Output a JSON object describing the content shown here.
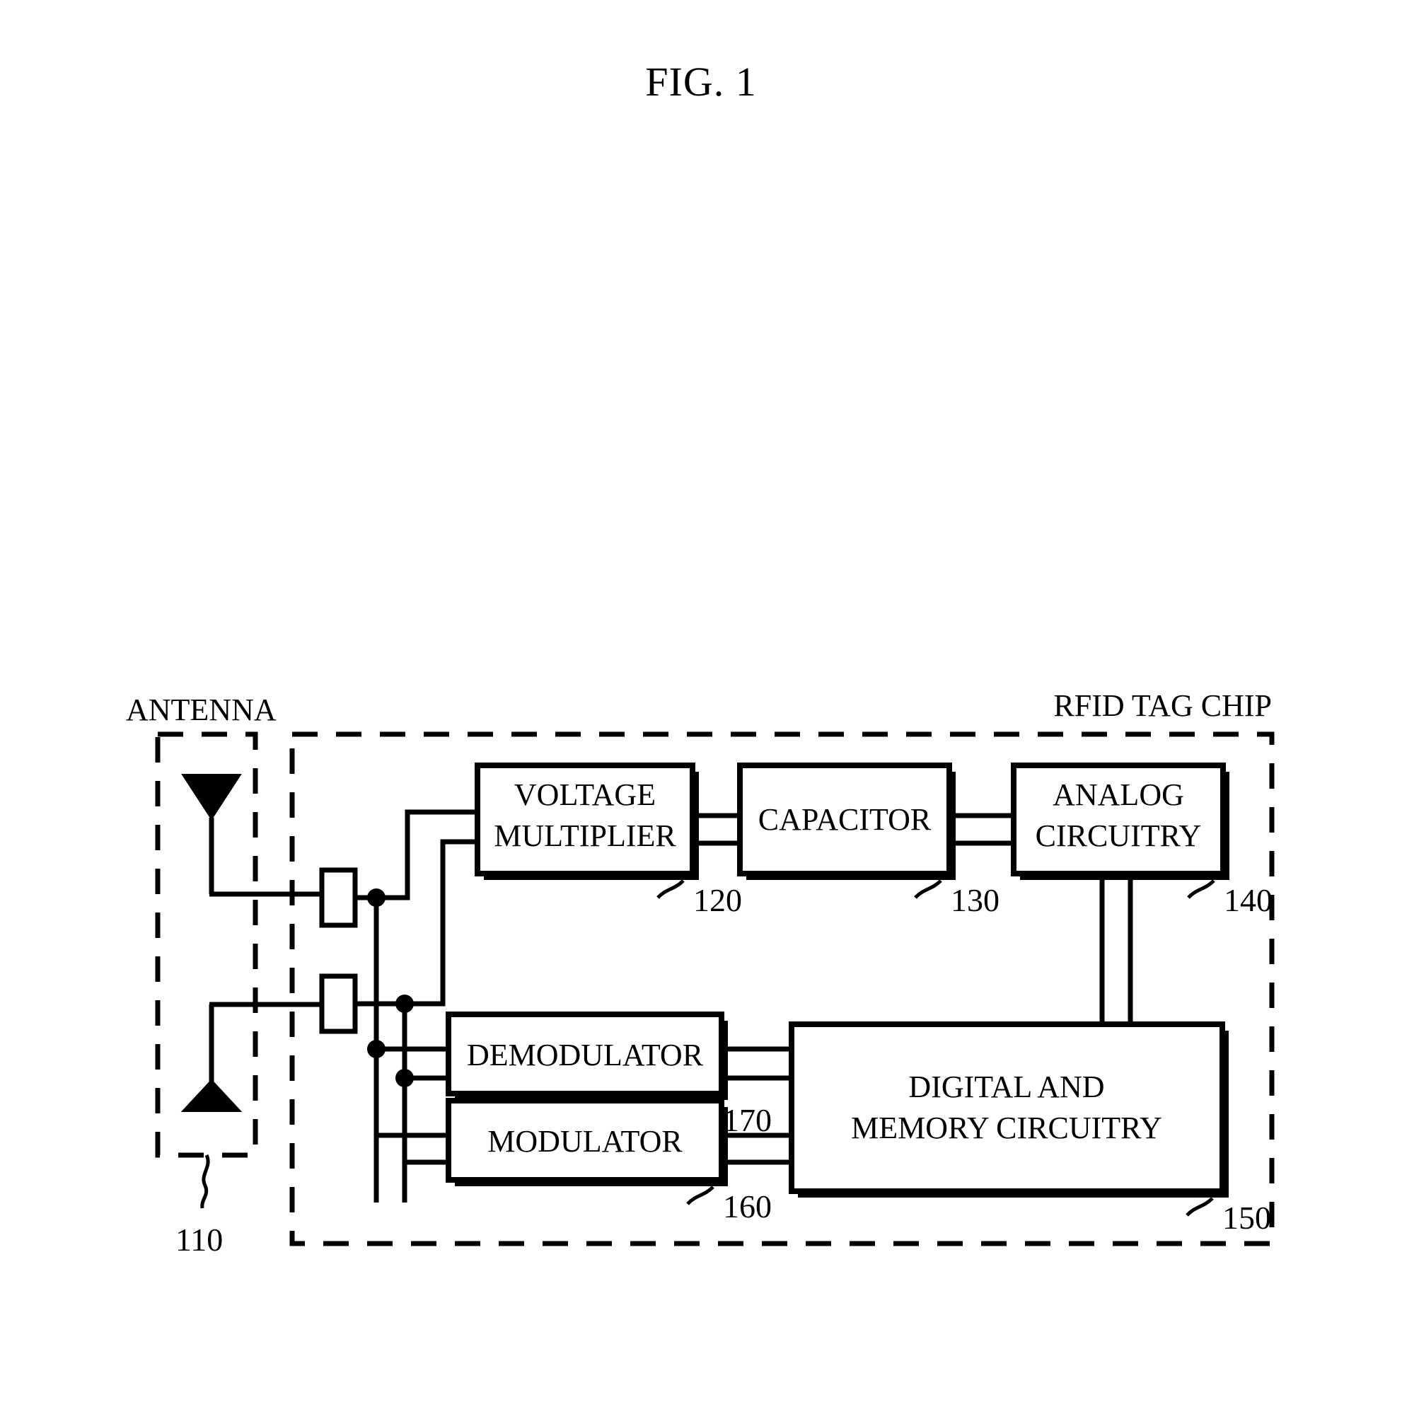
{
  "figure": {
    "title": "FIG. 1"
  },
  "labels": {
    "antenna": "ANTENNA",
    "chip": "RFID TAG CHIP"
  },
  "blocks": [
    {
      "id": "voltage-multiplier",
      "line1": "VOLTAGE",
      "line2": "MULTIPLIER",
      "ref": "120"
    },
    {
      "id": "capacitor",
      "line1": "CAPACITOR",
      "line2": "",
      "ref": "130"
    },
    {
      "id": "analog-circuitry",
      "line1": "ANALOG",
      "line2": "CIRCUITRY",
      "ref": "140"
    },
    {
      "id": "digital-memory-circuitry",
      "line1": "DIGITAL AND",
      "line2": "MEMORY CIRCUITRY",
      "ref": "150"
    },
    {
      "id": "demodulator",
      "line1": "DEMODULATOR",
      "line2": "",
      "ref": "170"
    },
    {
      "id": "modulator",
      "line1": "MODULATOR",
      "line2": "",
      "ref": "160"
    }
  ],
  "references": {
    "antenna": "110",
    "voltage_multiplier": "120",
    "capacitor": "130",
    "analog_circuitry": "140",
    "digital_memory_circuitry": "150",
    "modulator": "160",
    "demodulator": "170"
  },
  "icons": {
    "antenna_top": "antenna-triangle-down-icon",
    "antenna_bottom": "antenna-triangle-up-icon",
    "pad_top": "bond-pad-icon",
    "pad_bottom": "bond-pad-icon"
  },
  "colors": {
    "stroke": "#000000",
    "fill": "#ffffff",
    "background": "#ffffff"
  }
}
